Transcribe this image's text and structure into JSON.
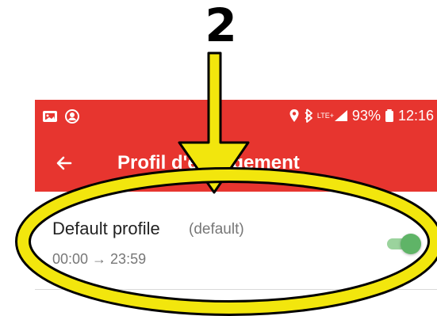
{
  "annotation": {
    "step_number": "2"
  },
  "status_bar": {
    "network": "LTE+",
    "battery": "93%",
    "time": "12:16"
  },
  "toolbar": {
    "title": "Profil d'engagement"
  },
  "profile": {
    "name": "Default profile",
    "tag": "(default)",
    "schedule": "00:00 → 23:59",
    "enabled": true
  },
  "colors": {
    "app_red": "#e7352f",
    "annotation_yellow": "#f2e60d",
    "switch_green": "#5fb467",
    "switch_track": "#9bd39d"
  },
  "icons": {
    "status_left": [
      "gallery-icon",
      "profile-icon"
    ],
    "status_right": [
      "location-icon",
      "bluetooth-icon",
      "signal-icon",
      "battery-icon"
    ],
    "toolbar": [
      "back-arrow-icon"
    ],
    "annotation": [
      "annotation-arrow",
      "annotation-ellipse"
    ]
  }
}
